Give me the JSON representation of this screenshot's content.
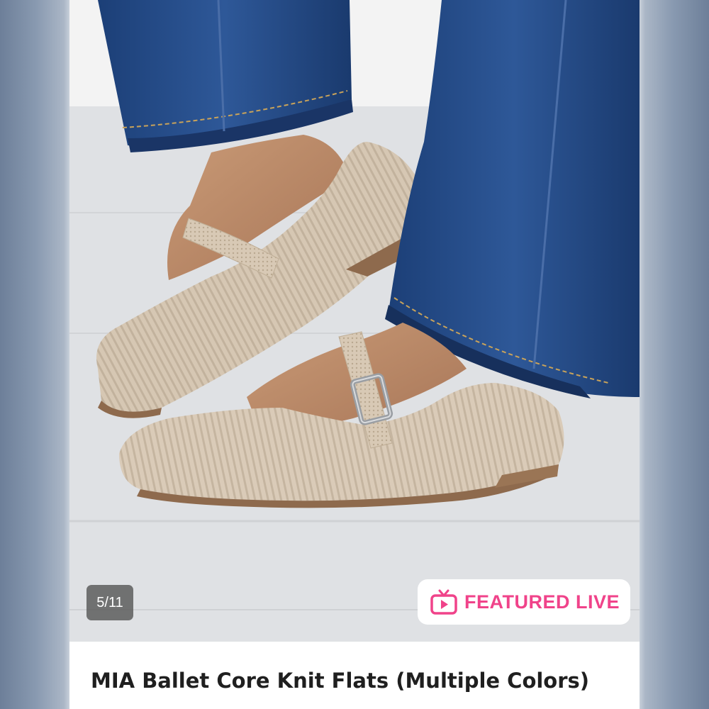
{
  "carousel": {
    "counter": "5/11"
  },
  "badge": {
    "label": "FEATURED LIVE",
    "icon": "tv-play-icon",
    "color": "#f0438a"
  },
  "product": {
    "title": "MIA Ballet Core Knit Flats (Multiple Colors)"
  }
}
